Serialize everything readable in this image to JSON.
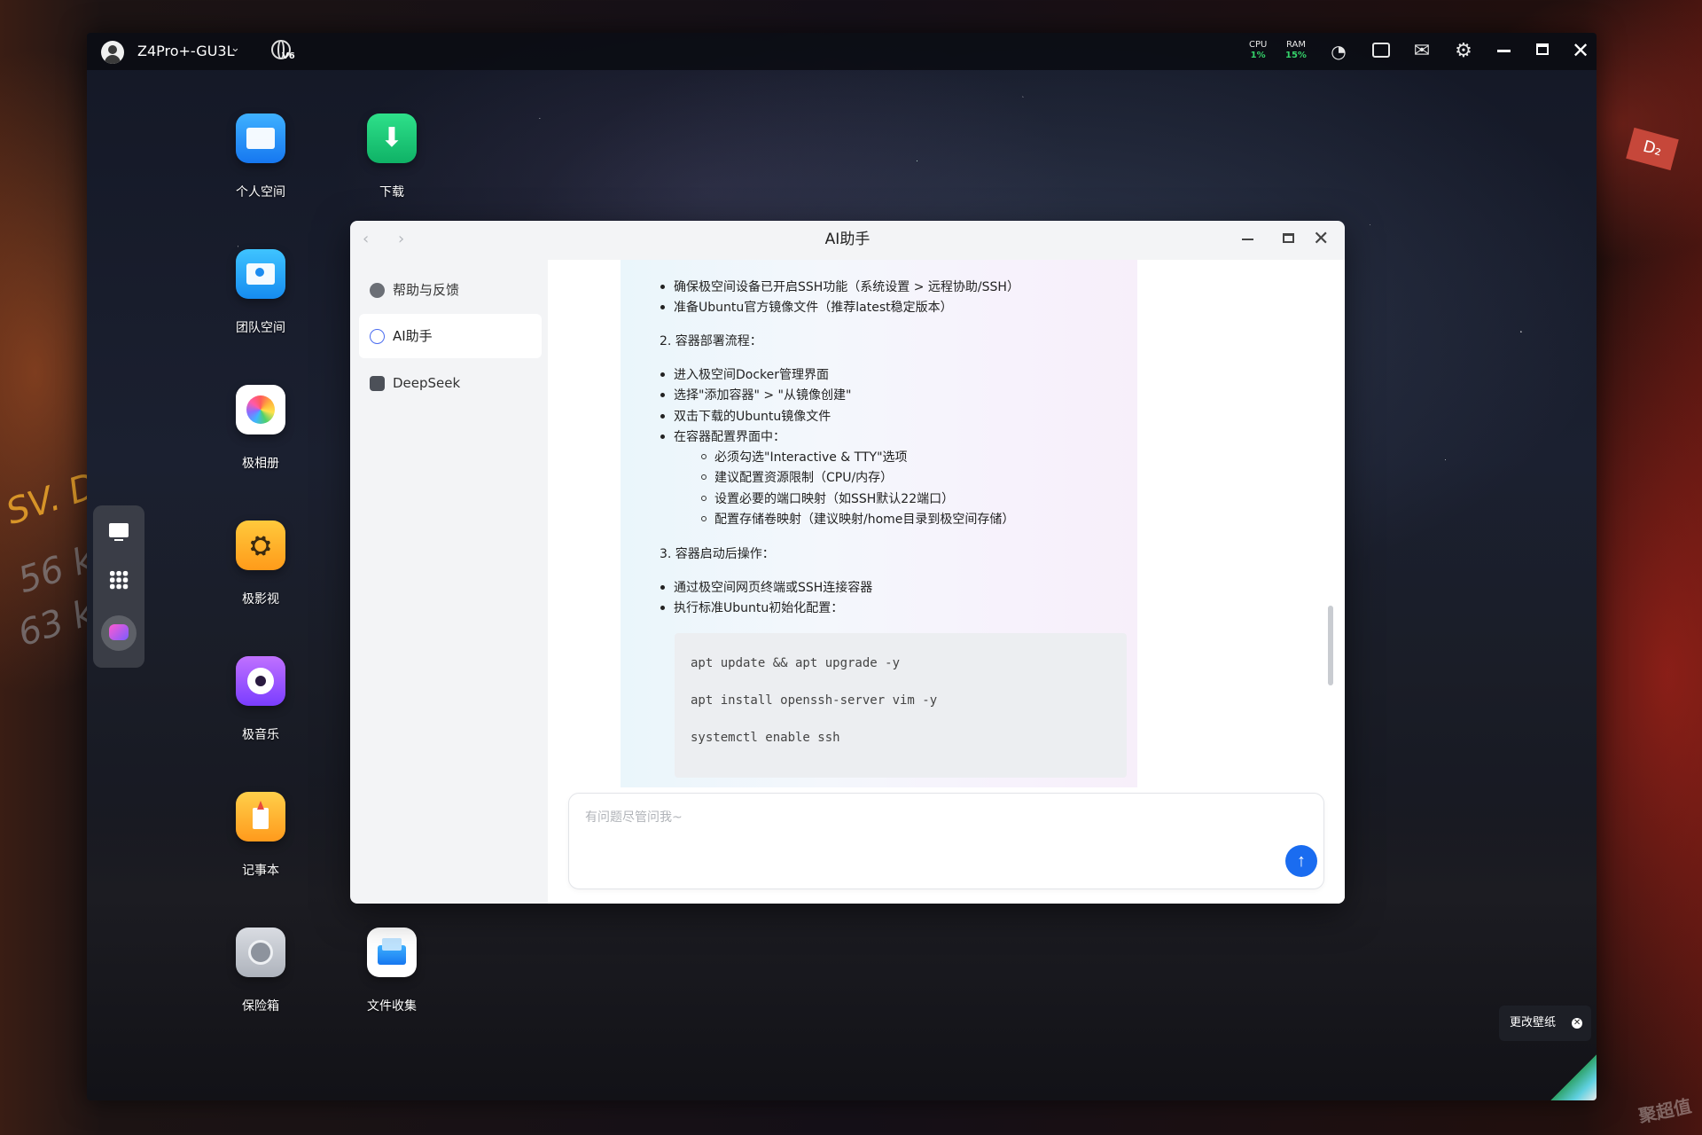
{
  "topbar": {
    "device_name": "Z4Pro+-GU3L",
    "network_label": "V6",
    "cpu_label": "CPU",
    "cpu_value": "1%",
    "ram_label": "RAM",
    "ram_value": "15%"
  },
  "desktop": {
    "apps": [
      {
        "label": "个人空间",
        "icon": "folder-icon"
      },
      {
        "label": "下载",
        "icon": "download-icon"
      },
      {
        "label": "团队空间",
        "icon": "team-folder-icon"
      },
      {
        "label": "极相册",
        "icon": "photos-icon"
      },
      {
        "label": "极影视",
        "icon": "video-icon"
      },
      {
        "label": "极音乐",
        "icon": "music-icon"
      },
      {
        "label": "记事本",
        "icon": "notepad-icon"
      },
      {
        "label": "保险箱",
        "icon": "safe-icon"
      },
      {
        "label": "文件收集",
        "icon": "file-collect-icon"
      }
    ]
  },
  "wallpaper": {
    "change_label": "更改壁纸"
  },
  "dialog": {
    "title": "AI助手",
    "sidebar": [
      {
        "label": "帮助与反馈",
        "icon": "help-icon"
      },
      {
        "label": "AI助手",
        "icon": "ai-icon",
        "active": true
      },
      {
        "label": "DeepSeek",
        "icon": "deepseek-icon"
      }
    ],
    "message": {
      "prep_items": [
        "确保极空间设备已开启SSH功能（系统设置 > 远程协助/SSH）",
        "准备Ubuntu官方镜像文件（推荐latest稳定版本）"
      ],
      "heading_2": "2. 容器部署流程：",
      "deploy_items": [
        "进入极空间Docker管理界面",
        "选择\"添加容器\" > \"从镜像创建\"",
        "双击下载的Ubuntu镜像文件",
        "在容器配置界面中："
      ],
      "config_items": [
        "必须勾选\"Interactive & TTY\"选项",
        "建议配置资源限制（CPU/内存）",
        "设置必要的端口映射（如SSH默认22端口）",
        "配置存储卷映射（建议映射/home目录到极空间存储）"
      ],
      "heading_3": "3. 容器启动后操作：",
      "post_items": [
        "通过极空间网页终端或SSH连接容器",
        "执行标准Ubuntu初始化配置："
      ],
      "code_lines": [
        "apt update && apt upgrade -y",
        "apt install openssh-server vim -y",
        "systemctl enable ssh"
      ]
    },
    "input_placeholder": "有问题尽管问我~"
  },
  "outer": {
    "left_text": "SV. D",
    "num_1": "56 k",
    "num_2": "63 k",
    "tag": "D₂",
    "watermark": "聚超值"
  }
}
